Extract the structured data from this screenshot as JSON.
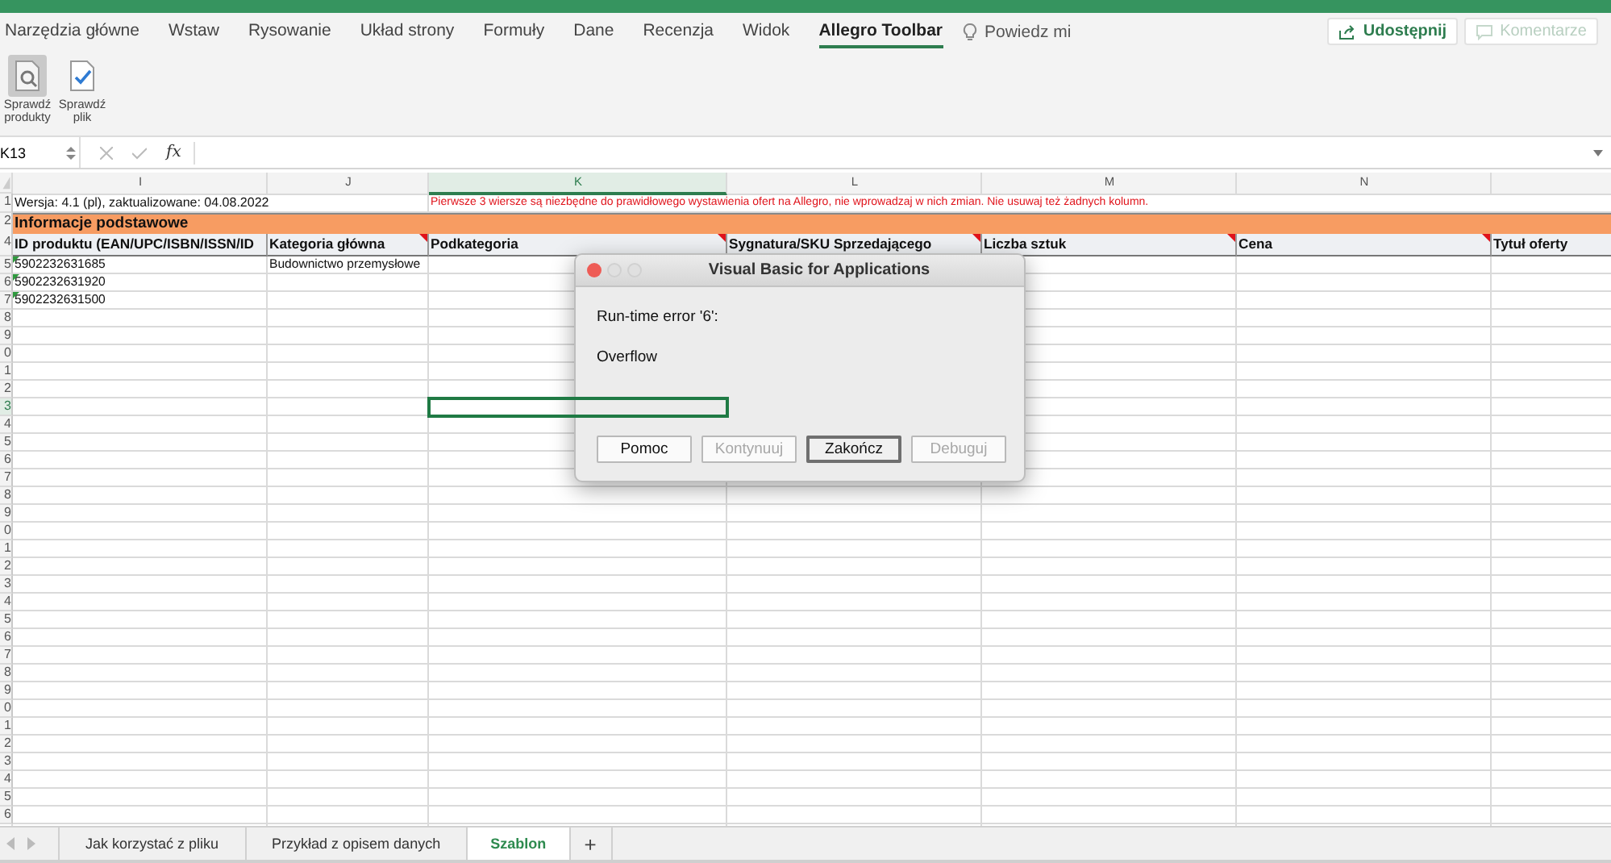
{
  "ribbon": {
    "tabs": [
      {
        "label": "Narzędzia główne",
        "selected": false
      },
      {
        "label": "Wstaw",
        "selected": false
      },
      {
        "label": "Rysowanie",
        "selected": false
      },
      {
        "label": "Układ strony",
        "selected": false
      },
      {
        "label": "Formuły",
        "selected": false
      },
      {
        "label": "Dane",
        "selected": false
      },
      {
        "label": "Recenzja",
        "selected": false
      },
      {
        "label": "Widok",
        "selected": false
      },
      {
        "label": "Allegro Toolbar",
        "selected": true
      }
    ],
    "tell_me": "Powiedz mi",
    "share_button": "Udostępnij",
    "comments_button": {
      "label": "Komentarze",
      "disabled": true
    },
    "tools": [
      {
        "label": "Sprawdź produkty",
        "kind": "inspect",
        "pressed": true
      },
      {
        "label": "Sprawdź plik",
        "kind": "validate",
        "pressed": false
      }
    ]
  },
  "formula_bar": {
    "name_box": "K13",
    "function_label": "fx"
  },
  "sheet": {
    "columns": [
      {
        "label": "I",
        "selected": false
      },
      {
        "label": "J",
        "selected": false
      },
      {
        "label": "K",
        "selected": true
      },
      {
        "label": "L",
        "selected": false
      },
      {
        "label": "M",
        "selected": false
      },
      {
        "label": "N",
        "selected": false
      }
    ],
    "rows": [
      {
        "kind": "info",
        "number": "1",
        "selected": false,
        "note": "Wersja: 4.1 (pl), zaktualizowane: 04.08.2022",
        "warning": "Pierwsze 3 wiersze są niezbędne do prawidłowego wystawienia ofert na Allegro, nie wprowadzaj w nich zmian. Nie usuwaj też żadnych kolumn."
      },
      {
        "kind": "section",
        "number": "2",
        "selected": false,
        "title": "Informacje podstawowe"
      },
      {
        "kind": "header",
        "number": "4",
        "selected": false,
        "cells": [
          {
            "text": "ID produktu (EAN/UPC/ISBN/ISSN/ID",
            "commented": false
          },
          {
            "text": "Kategoria główna",
            "commented": true
          },
          {
            "text": "Podkategoria",
            "commented": true
          },
          {
            "text": "Sygnatura/SKU Sprzedającego",
            "commented": true
          },
          {
            "text": "Liczba sztuk",
            "commented": true
          },
          {
            "text": "Cena",
            "commented": true
          },
          {
            "text": "Tytuł oferty"
          }
        ]
      },
      {
        "kind": "data",
        "number": "5",
        "selected": false,
        "cells": [
          {
            "text": "5902232631685",
            "flagged": true
          },
          {
            "text": "Budownictwo przemysłowe",
            "flagged": false
          }
        ]
      },
      {
        "kind": "data",
        "number": "6",
        "selected": false,
        "cells": [
          {
            "text": "5902232631920",
            "flagged": true
          }
        ]
      },
      {
        "kind": "data",
        "number": "7",
        "selected": false,
        "cells": [
          {
            "text": "5902232631500",
            "flagged": true
          }
        ]
      },
      {
        "kind": "data",
        "number": "8",
        "selected": false
      },
      {
        "kind": "data",
        "number": "9",
        "selected": false
      },
      {
        "kind": "data",
        "number": "0",
        "selected": false
      },
      {
        "kind": "data",
        "number": "1",
        "selected": false
      },
      {
        "kind": "data",
        "number": "2",
        "selected": false
      },
      {
        "kind": "data",
        "number": "3",
        "selected": true
      },
      {
        "kind": "data",
        "number": "4",
        "selected": false
      },
      {
        "kind": "data",
        "number": "5",
        "selected": false
      },
      {
        "kind": "data",
        "number": "6",
        "selected": false
      },
      {
        "kind": "data",
        "number": "7",
        "selected": false
      },
      {
        "kind": "data",
        "number": "8",
        "selected": false
      },
      {
        "kind": "data",
        "number": "9",
        "selected": false
      },
      {
        "kind": "data",
        "number": "0",
        "selected": false
      },
      {
        "kind": "data",
        "number": "1",
        "selected": false
      },
      {
        "kind": "data",
        "number": "2",
        "selected": false
      },
      {
        "kind": "data",
        "number": "3",
        "selected": false
      },
      {
        "kind": "data",
        "number": "4",
        "selected": false
      },
      {
        "kind": "data",
        "number": "5",
        "selected": false
      },
      {
        "kind": "data",
        "number": "6",
        "selected": false
      },
      {
        "kind": "data",
        "number": "7",
        "selected": false
      },
      {
        "kind": "data",
        "number": "8",
        "selected": false
      },
      {
        "kind": "data",
        "number": "9",
        "selected": false
      },
      {
        "kind": "data",
        "number": "0",
        "selected": false
      },
      {
        "kind": "data",
        "number": "1",
        "selected": false
      },
      {
        "kind": "data",
        "number": "2",
        "selected": false
      },
      {
        "kind": "data",
        "number": "3",
        "selected": false
      },
      {
        "kind": "data",
        "number": "4",
        "selected": false
      },
      {
        "kind": "data",
        "number": "5",
        "selected": false
      },
      {
        "kind": "data",
        "number": "6",
        "selected": false
      }
    ]
  },
  "dialog": {
    "title": "Visual Basic for Applications",
    "message": "Run-time error '6':",
    "detail": "Overflow",
    "buttons": [
      {
        "label": "Pomoc",
        "disabled": false,
        "default": false
      },
      {
        "label": "Kontynuuj",
        "disabled": true,
        "default": false
      },
      {
        "label": "Zakończ",
        "disabled": false,
        "default": true
      },
      {
        "label": "Debuguj",
        "disabled": true,
        "default": false
      }
    ]
  },
  "sheet_tabs": {
    "tabs": [
      {
        "label": "Jak korzystać z pliku",
        "selected": false
      },
      {
        "label": "Przykład z opisem danych",
        "selected": false
      },
      {
        "label": "Szablon",
        "selected": true
      }
    ],
    "add_label": "+"
  }
}
